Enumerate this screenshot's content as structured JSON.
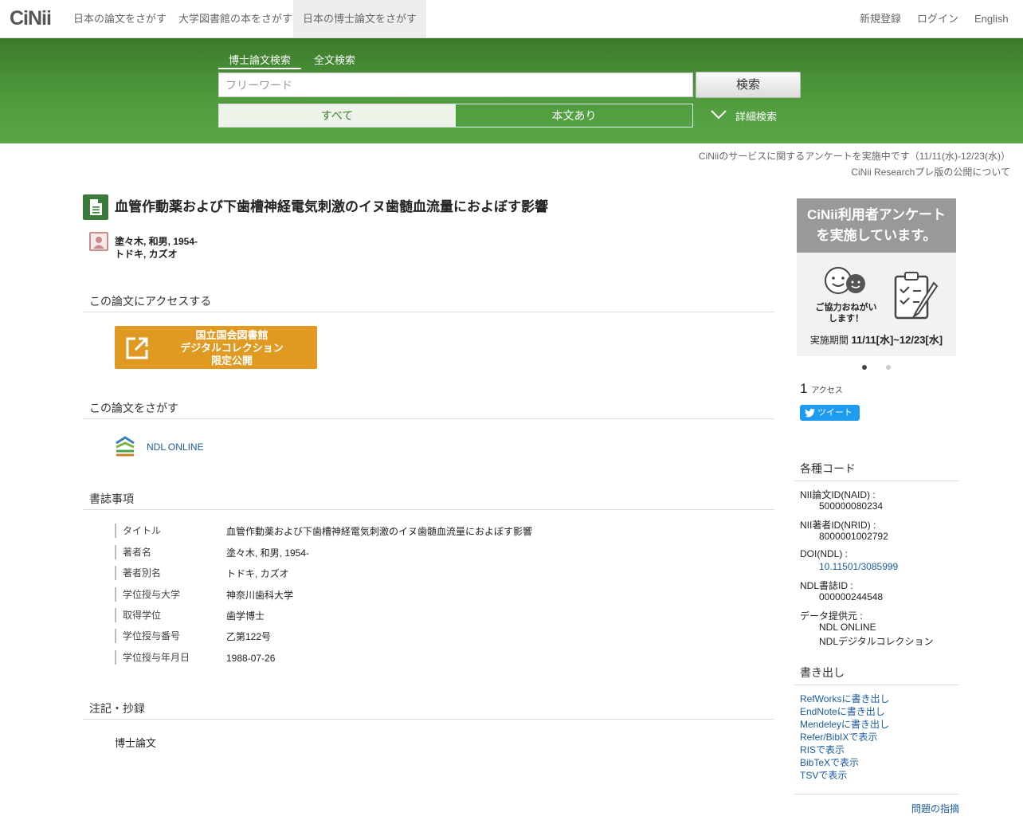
{
  "nav": {
    "logo": "CiNii",
    "tabs": [
      "日本の論文をさがす",
      "大学図書館の本をさがす",
      "日本の博士論文をさがす"
    ],
    "register": "新規登録",
    "login": "ログイン",
    "english": "English"
  },
  "search": {
    "tabs": [
      "博士論文検索",
      "全文検索"
    ],
    "placeholder": "フリーワード",
    "button": "検索",
    "filter_all": "すべて",
    "filter_body": "本文あり",
    "advanced": "詳細検索"
  },
  "notices": [
    "CiNiiのサービスに関するアンケートを実施中です（11/11(水)-12/23(水)）",
    "CiNii Researchプレ版の公開について"
  ],
  "paper": {
    "title": "血管作動薬および下歯槽神経電気刺激のイヌ歯髄血流量におよぼす影響",
    "author_lines": [
      "塗々木, 和男, 1954-",
      "トドキ, カズオ"
    ]
  },
  "access": {
    "heading": "この論文にアクセスする",
    "ndl_button": [
      "国立国会図書館",
      "デジタルコレクション",
      "限定公開"
    ]
  },
  "find": {
    "heading": "この論文をさがす",
    "ndl_online": "NDL ONLINE"
  },
  "bib": {
    "heading": "書誌事項",
    "rows": [
      {
        "k": "タイトル",
        "v": "血管作動薬および下歯槽神経電気刺激のイヌ歯髄血流量におよぼす影響"
      },
      {
        "k": "著者名",
        "v": "塗々木, 和男, 1954-"
      },
      {
        "k": "著者別名",
        "v": "トドキ, カズオ"
      },
      {
        "k": "学位授与大学",
        "v": "神奈川歯科大学"
      },
      {
        "k": "取得学位",
        "v": "歯学博士"
      },
      {
        "k": "学位授与番号",
        "v": "乙第122号"
      },
      {
        "k": "学位授与年月日",
        "v": "1988-07-26"
      }
    ]
  },
  "notes": {
    "heading": "注記・抄録",
    "body": "博士論文"
  },
  "sidebar": {
    "banner_title": [
      "CiNii利用者アンケート",
      "を実施しています。"
    ],
    "banner_help": [
      "ご協力おねがい",
      "します！"
    ],
    "banner_period_label": "実施期間",
    "banner_period": "11/11[水]~12/23[水]",
    "access_count": "1",
    "access_label": "アクセス",
    "tweet": "ツイート",
    "codes_heading": "各種コード",
    "codes": [
      {
        "k": "NII論文ID(NAID) :",
        "v": [
          "500000080234"
        ]
      },
      {
        "k": "NII著者ID(NRID) :",
        "v": [
          "8000001002792"
        ]
      },
      {
        "k": "DOI(NDL) :",
        "v": [
          "10.11501/3085999"
        ]
      },
      {
        "k": "NDL書誌ID :",
        "v": [
          "000000244548"
        ]
      },
      {
        "k": "データ提供元 :",
        "v": [
          "NDL ONLINE",
          "NDLデジタルコレクション"
        ]
      }
    ],
    "export_heading": "書き出し",
    "exports": [
      "RefWorksに書き出し",
      "EndNoteに書き出し",
      "Mendeleyに書き出し",
      "Refer/BibIXで表示",
      "RISで表示",
      "BibTeXで表示",
      "TSVで表示"
    ],
    "report": "問題の指摘"
  }
}
